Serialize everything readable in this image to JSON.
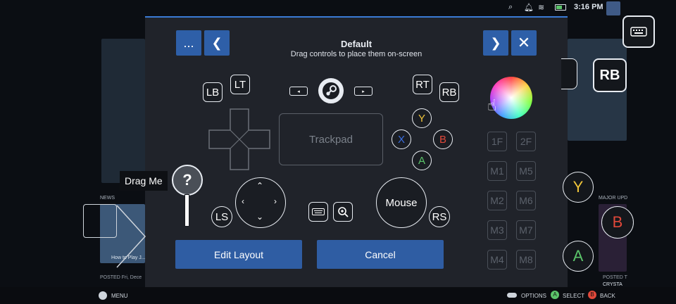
{
  "status": {
    "time": "3:16 PM"
  },
  "dialog": {
    "title": "Default",
    "subtitle": "Drag controls to place them on-screen",
    "more_label": "...",
    "edit_layout_label": "Edit Layout",
    "cancel_label": "Cancel"
  },
  "controls": {
    "lb": "LB",
    "lt": "LT",
    "rt": "RT",
    "rb": "RB",
    "ls": "LS",
    "rs": "RS",
    "y": "Y",
    "x": "X",
    "b": "B",
    "a": "A",
    "trackpad": "Trackpad",
    "mouse": "Mouse",
    "drag_me": "Drag Me",
    "question": "?"
  },
  "macro_buttons": [
    "1F",
    "2F",
    "M1",
    "M5",
    "M2",
    "M6",
    "M3",
    "M7",
    "M4",
    "M8"
  ],
  "overlay": {
    "rb": "RB",
    "y": "Y",
    "b": "B",
    "a": "A"
  },
  "background": {
    "news_label": "NEWS",
    "major_label": "MAJOR UPD",
    "card_caption": "How to Play J...",
    "posted": "POSTED Fri, Dece",
    "posted_right": "POSTED T",
    "crystal": "CRYSTA"
  },
  "footer": {
    "menu": "MENU",
    "options": "OPTIONS",
    "select": "SELECT",
    "back": "BACK"
  },
  "colors": {
    "accent": "#2f5da3",
    "y": "#f0c53a",
    "x": "#3b6fe0",
    "b": "#e0483a",
    "a": "#5bc46a"
  }
}
